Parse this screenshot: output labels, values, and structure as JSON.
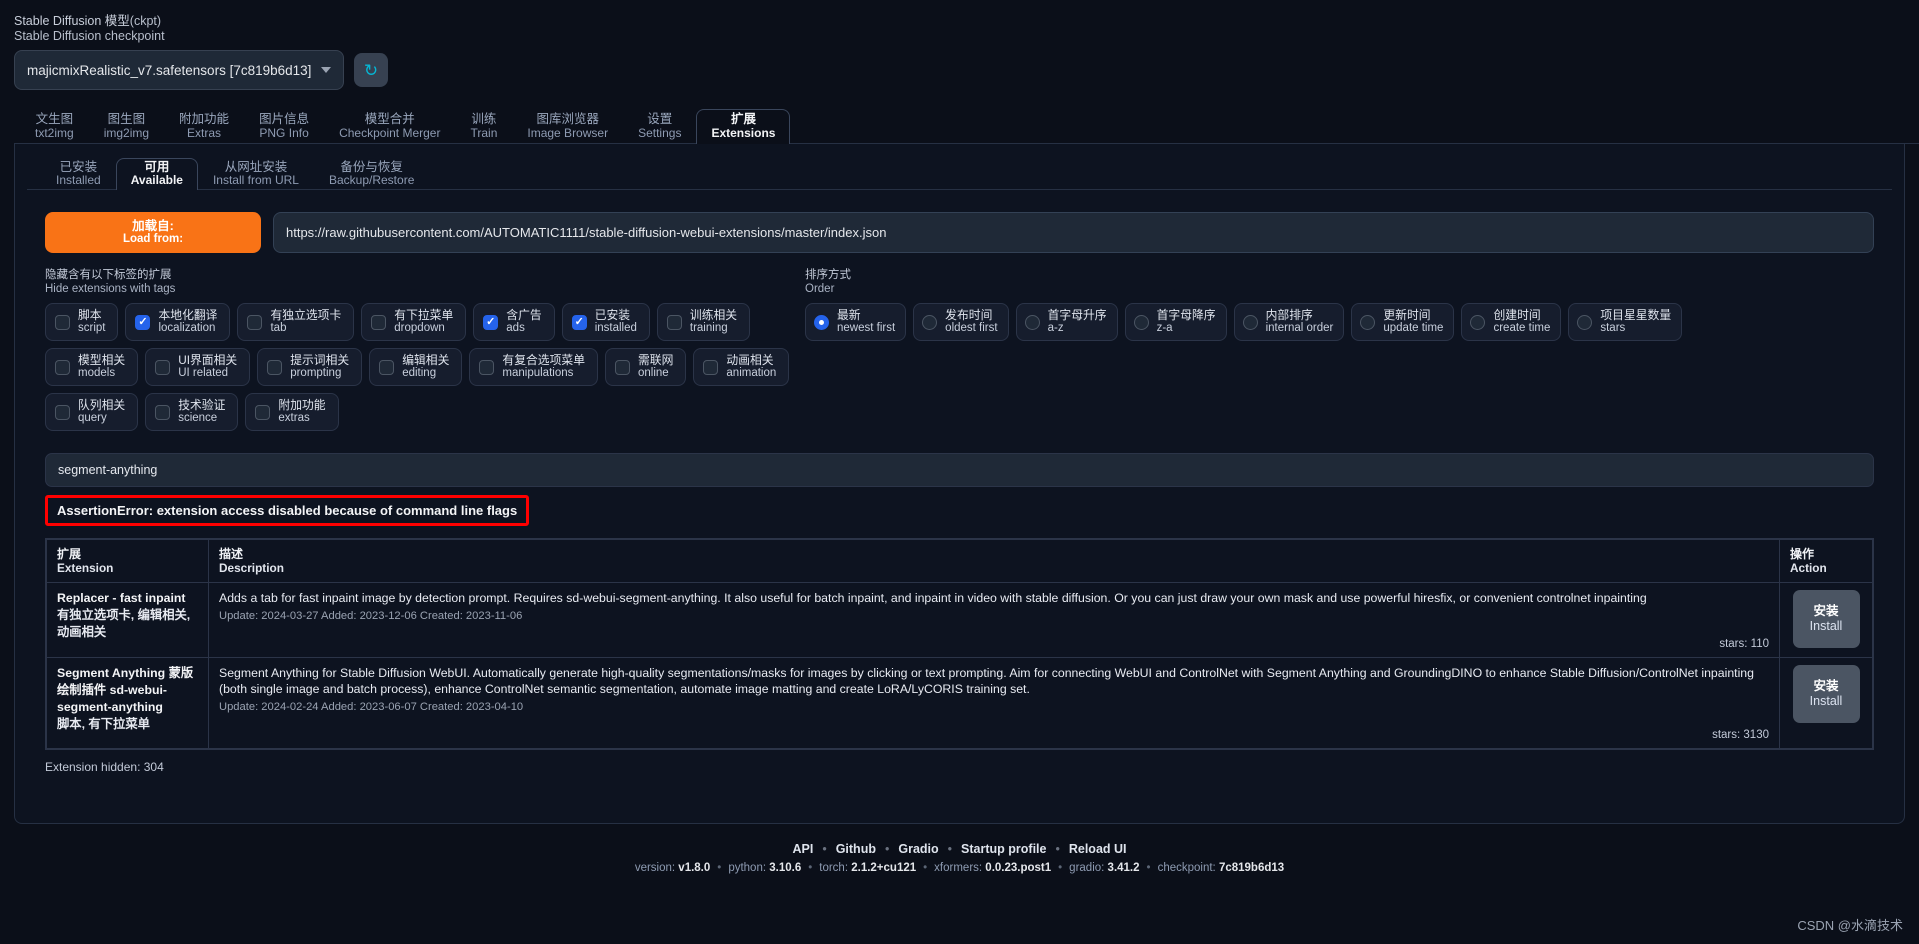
{
  "checkpoint": {
    "label_cn": "Stable Diffusion 模型",
    "label_suffix": "(ckpt)",
    "label_en": "Stable Diffusion checkpoint",
    "value": "majicmixRealistic_v7.safetensors [7c819b6d13]",
    "refresh_icon": "↻"
  },
  "main_tabs": [
    {
      "cn": "文生图",
      "en": "txt2img",
      "active": false
    },
    {
      "cn": "图生图",
      "en": "img2img",
      "active": false
    },
    {
      "cn": "附加功能",
      "en": "Extras",
      "active": false
    },
    {
      "cn": "图片信息",
      "en": "PNG Info",
      "active": false
    },
    {
      "cn": "模型合并",
      "en": "Checkpoint Merger",
      "active": false
    },
    {
      "cn": "训练",
      "en": "Train",
      "active": false
    },
    {
      "cn": "图库浏览器",
      "en": "Image Browser",
      "active": false
    },
    {
      "cn": "设置",
      "en": "Settings",
      "active": false
    },
    {
      "cn": "扩展",
      "en": "Extensions",
      "active": true
    }
  ],
  "sub_tabs": [
    {
      "cn": "已安装",
      "en": "Installed",
      "active": false
    },
    {
      "cn": "可用",
      "en": "Available",
      "active": true
    },
    {
      "cn": "从网址安装",
      "en": "Install from URL",
      "active": false
    },
    {
      "cn": "备份与恢复",
      "en": "Backup/Restore",
      "active": false
    }
  ],
  "load_from": {
    "button_cn": "加载自:",
    "button_en": "Load from:",
    "url": "https://raw.githubusercontent.com/AUTOMATIC1111/stable-diffusion-webui-extensions/master/index.json"
  },
  "tags": {
    "label_cn": "隐藏含有以下标签的扩展",
    "label_en": "Hide extensions with tags",
    "items": [
      {
        "cn": "脚本",
        "en": "script",
        "checked": false
      },
      {
        "cn": "本地化翻译",
        "en": "localization",
        "checked": true
      },
      {
        "cn": "有独立选项卡",
        "en": "tab",
        "checked": false
      },
      {
        "cn": "有下拉菜单",
        "en": "dropdown",
        "checked": false
      },
      {
        "cn": "含广告",
        "en": "ads",
        "checked": true
      },
      {
        "cn": "已安装",
        "en": "installed",
        "checked": true
      },
      {
        "cn": "训练相关",
        "en": "training",
        "checked": false
      },
      {
        "cn": "模型相关",
        "en": "models",
        "checked": false
      },
      {
        "cn": "UI界面相关",
        "en": "UI related",
        "checked": false
      },
      {
        "cn": "提示词相关",
        "en": "prompting",
        "checked": false
      },
      {
        "cn": "编辑相关",
        "en": "editing",
        "checked": false
      },
      {
        "cn": "有复合选项菜单",
        "en": "manipulations",
        "checked": false
      },
      {
        "cn": "需联网",
        "en": "online",
        "checked": false
      },
      {
        "cn": "动画相关",
        "en": "animation",
        "checked": false
      },
      {
        "cn": "队列相关",
        "en": "query",
        "checked": false
      },
      {
        "cn": "技术验证",
        "en": "science",
        "checked": false
      },
      {
        "cn": "附加功能",
        "en": "extras",
        "checked": false
      }
    ]
  },
  "order": {
    "label_cn": "排序方式",
    "label_en": "Order",
    "items": [
      {
        "cn": "最新",
        "en": "newest first",
        "selected": true
      },
      {
        "cn": "发布时间",
        "en": "oldest first",
        "selected": false
      },
      {
        "cn": "首字母升序",
        "en": "a-z",
        "selected": false
      },
      {
        "cn": "首字母降序",
        "en": "z-a",
        "selected": false
      },
      {
        "cn": "内部排序",
        "en": "internal order",
        "selected": false
      },
      {
        "cn": "更新时间",
        "en": "update time",
        "selected": false
      },
      {
        "cn": "创建时间",
        "en": "create time",
        "selected": false
      },
      {
        "cn": "项目星星数量",
        "en": "stars",
        "selected": false
      }
    ]
  },
  "search": {
    "value": "segment-anything",
    "placeholder": ""
  },
  "error": {
    "message": "AssertionError: extension access disabled because of command line flags"
  },
  "table": {
    "headers": [
      {
        "cn": "扩展",
        "en": "Extension"
      },
      {
        "cn": "描述",
        "en": "Description"
      },
      {
        "cn": "操作",
        "en": "Action"
      }
    ],
    "rows": [
      {
        "name": "Replacer - fast inpaint",
        "tags": "有独立选项卡, 编辑相关, 动画相关",
        "description": "Adds a tab for fast inpaint image by detection prompt. Requires sd-webui-segment-anything. It also useful for batch inpaint, and inpaint in video with stable diffusion. Or you can just draw your own mask and use powerful hiresfix, or convenient controlnet inpainting",
        "meta": "Update: 2024-03-27 Added: 2023-12-06 Created: 2023-11-06",
        "stars": "stars: 110",
        "action_cn": "安装",
        "action_en": "Install"
      },
      {
        "name": "Segment Anything 蒙版绘制插件 sd-webui-segment-anything",
        "tags": "脚本, 有下拉菜单",
        "description": "Segment Anything for Stable Diffusion WebUI. Automatically generate high-quality segmentations/masks for images by clicking or text prompting. Aim for connecting WebUI and ControlNet with Segment Anything and GroundingDINO to enhance Stable Diffusion/ControlNet inpainting (both single image and batch process), enhance ControlNet semantic segmentation, automate image matting and create LoRA/LyCORIS training set.",
        "meta": "Update: 2024-02-24 Added: 2023-06-07 Created: 2023-04-10",
        "stars": "stars: 3130",
        "action_cn": "安装",
        "action_en": "Install"
      }
    ],
    "hidden_note": "Extension hidden: 304"
  },
  "footer": {
    "links": [
      "API",
      "Github",
      "Gradio",
      "Startup profile",
      "Reload UI"
    ],
    "version_label": "version:",
    "version": "v1.8.0",
    "python_label": "python:",
    "python": "3.10.6",
    "torch_label": "torch:",
    "torch": "2.1.2+cu121",
    "xformers_label": "xformers:",
    "xformers": "0.0.23.post1",
    "gradio_label": "gradio:",
    "gradio": "3.41.2",
    "checkpoint_label": "checkpoint:",
    "checkpoint": "7c819b6d13"
  },
  "watermark": "CSDN @水滴技术",
  "colors": {
    "accent": "#f97316",
    "selected": "#2563eb",
    "error": "#ff0000",
    "refresh": "#06b6d4"
  }
}
